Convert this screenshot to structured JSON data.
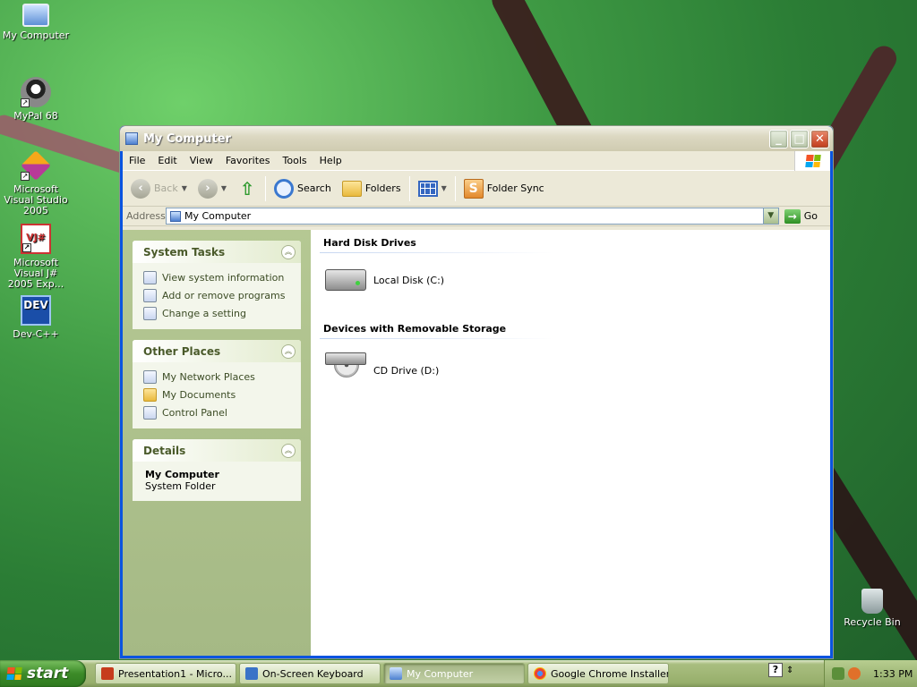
{
  "desktop": {
    "icons": [
      {
        "label": "My Computer"
      },
      {
        "label": "MyPal 68"
      },
      {
        "label": "Microsoft Visual Studio 2005"
      },
      {
        "label": "Microsoft Visual J# 2005 Exp..."
      },
      {
        "label": "Dev-C++"
      },
      {
        "label": "Recycle Bin"
      }
    ]
  },
  "window": {
    "title": "My Computer",
    "menu": [
      "File",
      "Edit",
      "View",
      "Favorites",
      "Tools",
      "Help"
    ],
    "toolbar": {
      "back": "Back",
      "search": "Search",
      "folders": "Folders",
      "folder_sync": "Folder Sync"
    },
    "address": {
      "label": "Address",
      "value": "My Computer",
      "go": "Go"
    },
    "system_tasks": {
      "title": "System Tasks",
      "items": [
        "View system information",
        "Add or remove programs",
        "Change a setting"
      ]
    },
    "other_places": {
      "title": "Other Places",
      "items": [
        "My Network Places",
        "My Documents",
        "Control Panel"
      ]
    },
    "details": {
      "title": "Details",
      "name": "My Computer",
      "type": "System Folder"
    },
    "groups": [
      {
        "title": "Hard Disk Drives",
        "items": [
          "Local Disk (C:)"
        ]
      },
      {
        "title": "Devices with Removable Storage",
        "items": [
          "CD Drive (D:)"
        ]
      }
    ]
  },
  "taskbar": {
    "start": "start",
    "buttons": [
      {
        "label": "Presentation1 - Micro..."
      },
      {
        "label": "On-Screen Keyboard"
      },
      {
        "label": "My Computer"
      },
      {
        "label": "Google Chrome Installer"
      }
    ],
    "clock": "1:33 PM"
  }
}
